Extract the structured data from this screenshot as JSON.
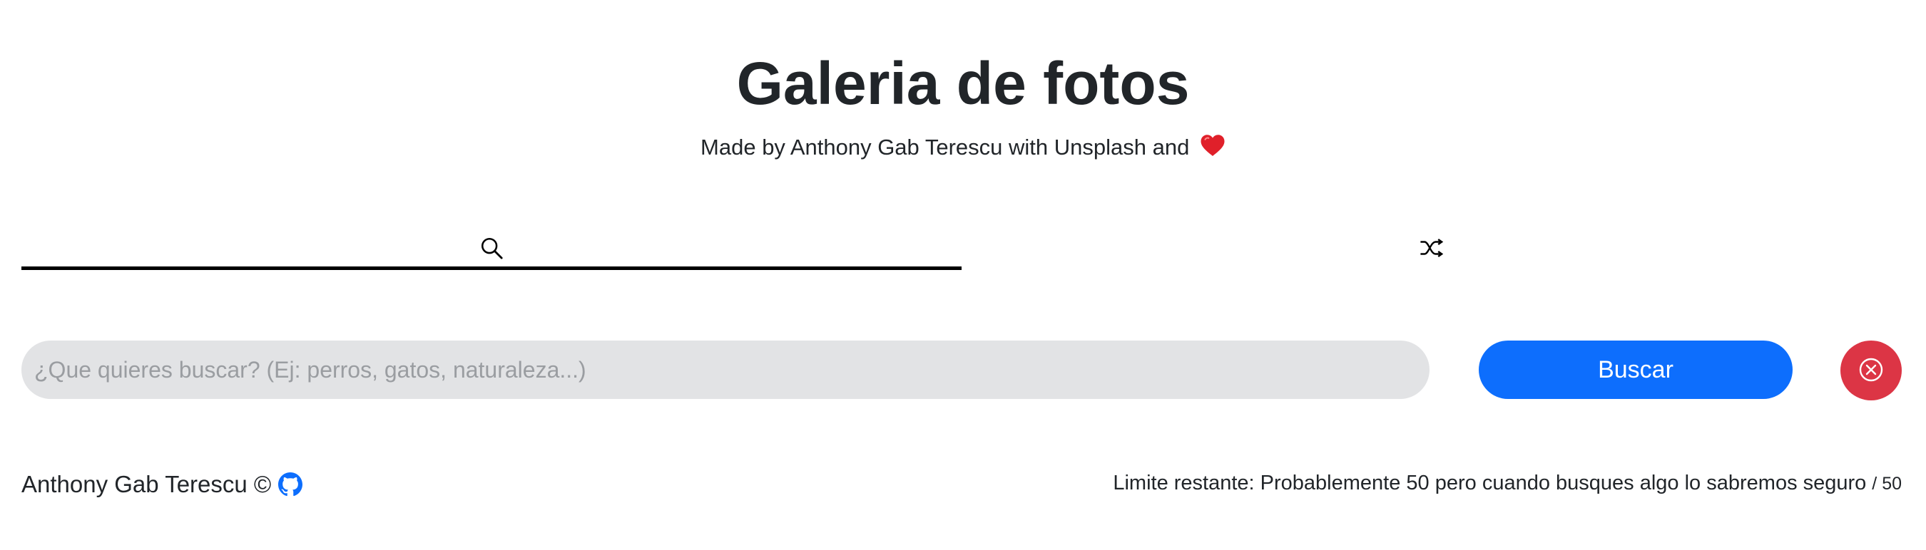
{
  "header": {
    "title": "Galeria de fotos",
    "subtitle": "Made by Anthony Gab Terescu with Unsplash and",
    "heart_icon": "red-heart-emoji"
  },
  "tabs": [
    {
      "name": "search",
      "icon": "search-icon",
      "active": true
    },
    {
      "name": "random",
      "icon": "shuffle-icon",
      "active": false
    }
  ],
  "search": {
    "placeholder": "¿Que quieres buscar? (Ej: perros, gatos, naturaleza...)",
    "value": "",
    "button_label": "Buscar",
    "clear_icon": "close-circle-icon"
  },
  "footer": {
    "author": "Anthony Gab Terescu ©",
    "github_icon": "github-icon",
    "limit_text": "Limite restante: Probablemente 50 pero cuando busques algo lo sabremos seguro",
    "limit_total": "/ 50"
  },
  "colors": {
    "primary": "#0d6efd",
    "danger": "#dc3545",
    "input_bg": "#e2e3e5",
    "text": "#212529",
    "heart": "#e0202a"
  }
}
